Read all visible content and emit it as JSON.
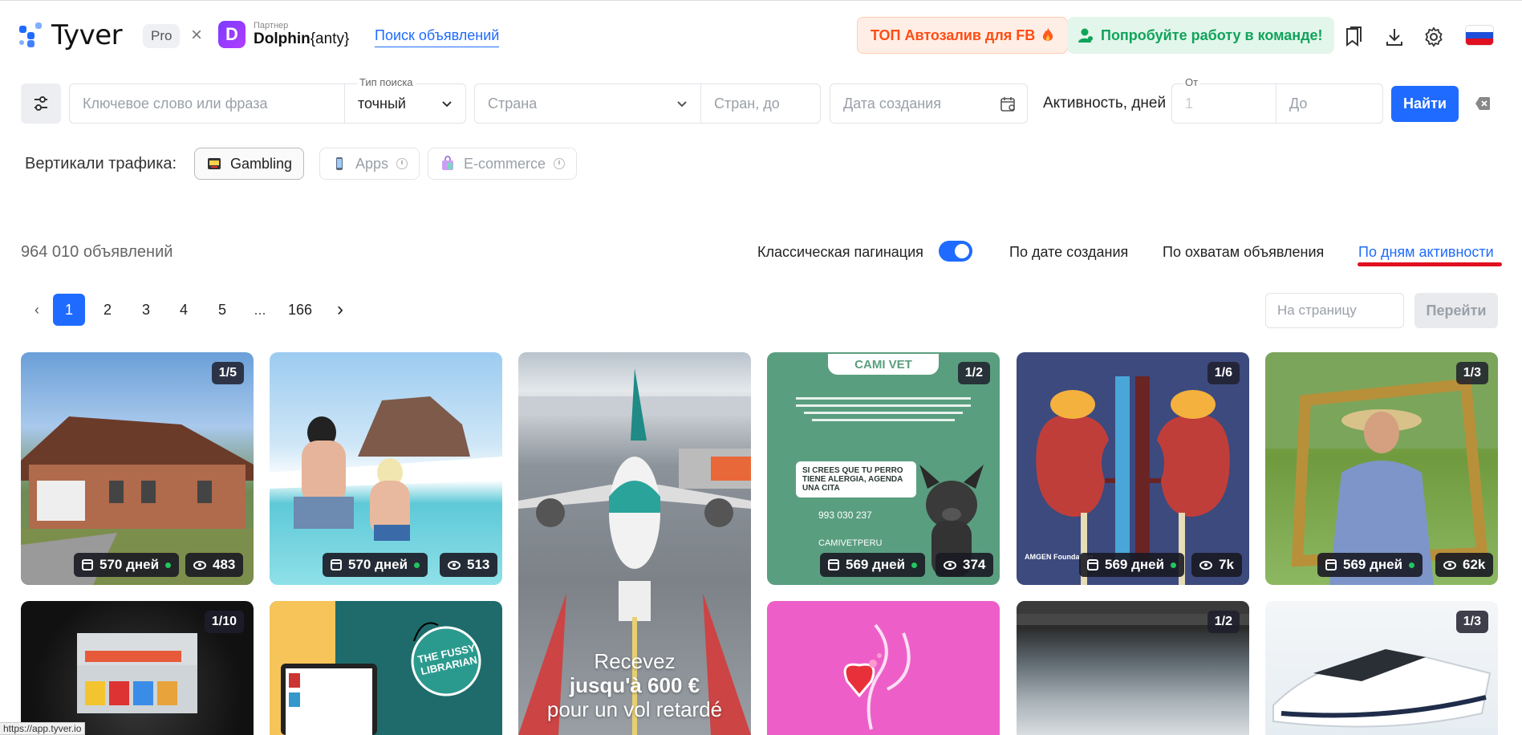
{
  "header": {
    "logo": "Tyver",
    "pro": "Pro",
    "cross": "×",
    "partner_small": "Партнер",
    "partner_name": "Dolphin",
    "partner_suffix": "{anty}",
    "search_link": "Поиск объявлений",
    "top_promo": "ТОП Автозалив для FB",
    "team_promo": "Попробуйте работу в команде!",
    "icons": [
      "bookmarks-icon",
      "download-icon",
      "settings-icon"
    ],
    "flag_colors": [
      "#ffffff",
      "#1f4fd8",
      "#e01020"
    ]
  },
  "search": {
    "keyword_placeholder": "Ключевое слово или фраза",
    "search_type_label": "Тип поиска",
    "search_type_value": "точный",
    "country_placeholder": "Страна",
    "country_to_placeholder": "Стран, до",
    "date_placeholder": "Дата создания",
    "activity_label": "Активность, дней",
    "from_label": "От",
    "from_value": "1",
    "to_placeholder": "До",
    "find_button": "Найти"
  },
  "verticals": {
    "label": "Вертикали трафика:",
    "items": [
      {
        "label": "Gambling",
        "active": true
      },
      {
        "label": "Apps",
        "active": false
      },
      {
        "label": "E-commerce",
        "active": false
      }
    ]
  },
  "results": {
    "count": "964 010 объявлений",
    "pagination_label": "Классическая пагинация",
    "pagination_enabled": true,
    "sorts": [
      "По дате создания",
      "По охватам объявления",
      "По дням активности"
    ],
    "active_sort": "По дням активности"
  },
  "pagination": {
    "prev": "‹",
    "pages": [
      "1",
      "2",
      "3",
      "4",
      "5",
      "...",
      "166"
    ],
    "next": "›",
    "current": "1",
    "goto_placeholder": "На страницу",
    "goto_button": "Перейти"
  },
  "cards": [
    {
      "count": "1/5",
      "days": "570 дней",
      "views": "483"
    },
    {
      "count": "",
      "days": "570 дней",
      "views": "513"
    },
    {
      "count": "",
      "days": "",
      "views": "",
      "text1": "Recevez",
      "text2": "jusqu'à 600 €",
      "text3": "pour un vol retardé"
    },
    {
      "count": "1/2",
      "days": "569 дней",
      "views": "374",
      "brand": "CAMI VET",
      "headline": "SI CREES QUE TU PERRO TIENE ALERGIA, AGENDA UNA CITA",
      "phone": "993 030 237",
      "handle": "CAMIVETPERU"
    },
    {
      "count": "1/6",
      "days": "569 дней",
      "views": "7k",
      "brand": "AMGEN Foundation"
    },
    {
      "count": "1/3",
      "days": "569 дней",
      "views": "62k"
    },
    {
      "count": "1/10"
    },
    {
      "count": "",
      "brand": "THE FUSSY LIBRARIAN"
    },
    {
      "count": ""
    },
    {
      "count": "1/2"
    },
    {
      "count": "1/3"
    }
  ],
  "status_url": "https://app.tyver.io"
}
